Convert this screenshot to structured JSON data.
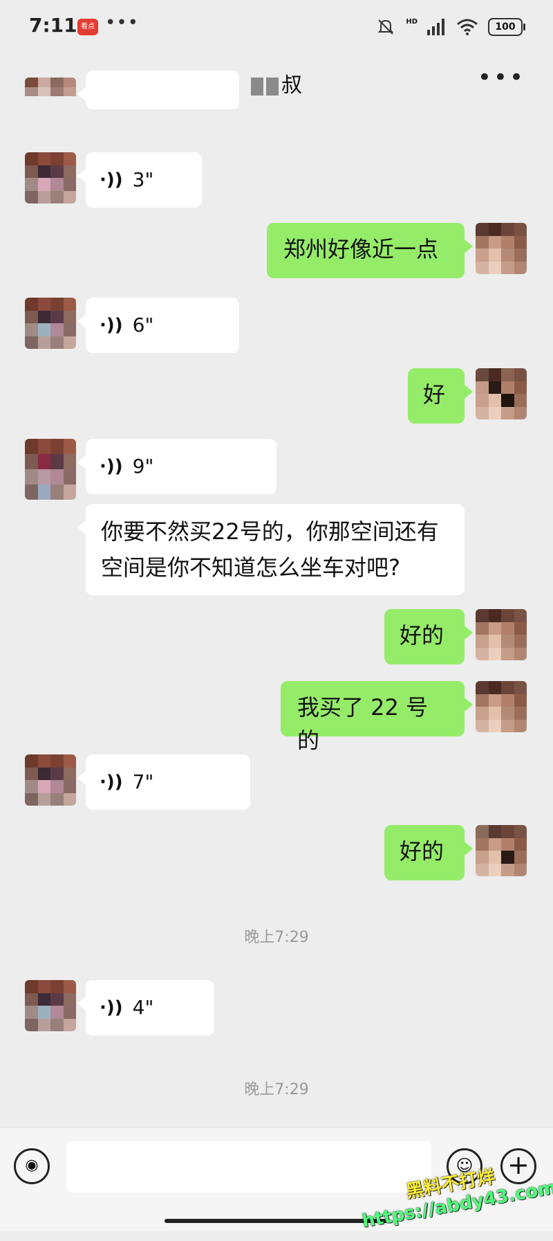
{
  "status_bar": {
    "time": "7:11",
    "app_badge": "看点",
    "dots": "•••",
    "signal": "HD",
    "battery": "100"
  },
  "header": {
    "title": "叔",
    "more": "•••"
  },
  "messages": [
    {
      "side": "in",
      "type": "voice",
      "duration": "3\""
    },
    {
      "side": "out",
      "type": "text",
      "text": "郑州好像近一点"
    },
    {
      "side": "in",
      "type": "voice",
      "duration": "6\""
    },
    {
      "side": "out",
      "type": "text",
      "text": "好"
    },
    {
      "side": "in",
      "type": "voice",
      "duration": "9\""
    },
    {
      "side": "in",
      "type": "text",
      "text": "你要不然买22号的，你那空间还有空间是你不知道怎么坐车对吧?"
    },
    {
      "side": "out",
      "type": "text",
      "text": "好的"
    },
    {
      "side": "out",
      "type": "text",
      "text": "我买了 22 号的"
    },
    {
      "side": "in",
      "type": "voice",
      "duration": "7\""
    },
    {
      "side": "out",
      "type": "text",
      "text": "好的"
    },
    {
      "side": "in",
      "type": "voice",
      "duration": "4\""
    }
  ],
  "timestamps": [
    "晚上7:29",
    "晚上7:29"
  ],
  "input_bar": {
    "placeholder": "",
    "voice_icon": "voice-toggle-icon",
    "emoji_icon": "emoji-icon",
    "plus_icon": "plus-icon",
    "plus": "+",
    "emoji": "☺",
    "voice": "◉"
  },
  "watermark": {
    "line1": "黑料不打烊",
    "line2": "https://abdy43.com"
  },
  "colors": {
    "outgoing_bubble": "#95ec69",
    "incoming_bubble": "#ffffff",
    "background": "#ededed"
  }
}
